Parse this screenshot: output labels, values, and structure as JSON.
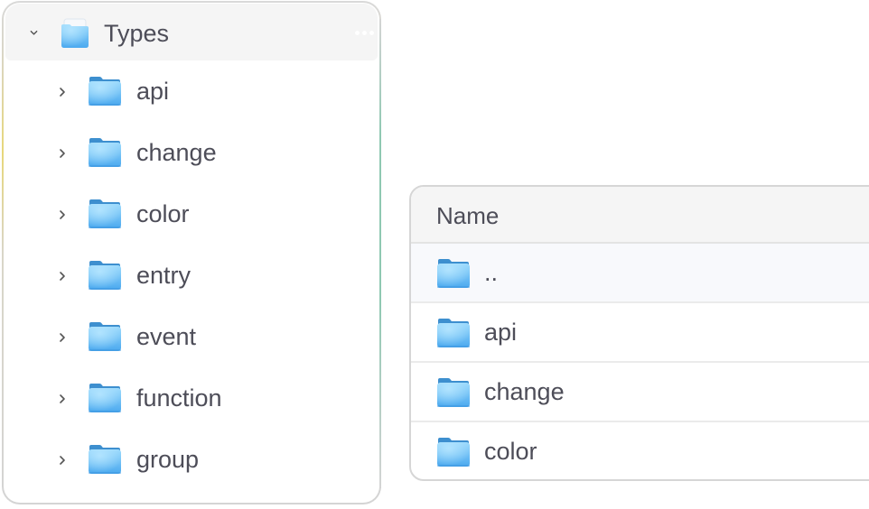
{
  "tree": {
    "root": {
      "label": "Types",
      "expanded": true,
      "icon": "open-folder-icon",
      "more_icon": "more-dots-icon"
    },
    "items": [
      {
        "label": "api",
        "icon": "folder-icon",
        "expanded": false
      },
      {
        "label": "change",
        "icon": "folder-icon",
        "expanded": false
      },
      {
        "label": "color",
        "icon": "folder-icon",
        "expanded": false
      },
      {
        "label": "entry",
        "icon": "folder-icon",
        "expanded": false
      },
      {
        "label": "event",
        "icon": "folder-icon",
        "expanded": false
      },
      {
        "label": "function",
        "icon": "folder-icon",
        "expanded": false
      },
      {
        "label": "group",
        "icon": "folder-icon",
        "expanded": false
      }
    ]
  },
  "table": {
    "columns": [
      {
        "label": "Name"
      }
    ],
    "rows": [
      {
        "label": "..",
        "icon": "folder-icon",
        "kind": "parent"
      },
      {
        "label": "api",
        "icon": "folder-icon"
      },
      {
        "label": "change",
        "icon": "folder-icon"
      },
      {
        "label": "color",
        "icon": "folder-icon"
      }
    ]
  },
  "colors": {
    "folder_top": "#8fd3fb",
    "folder_bottom": "#4aa8ef",
    "folder_tab": "#3f8fd0",
    "text": "#4d4d58",
    "header_bg": "#f5f5f5",
    "accent_border_yellow": "#e7d77a",
    "accent_border_green": "#8fc8b2"
  }
}
